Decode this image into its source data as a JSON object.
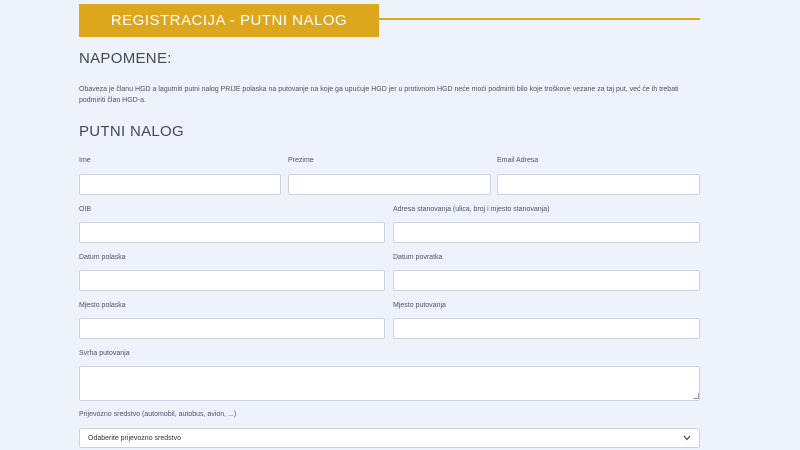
{
  "header": {
    "title": "REGISTRACIJA - PUTNI NALOG"
  },
  "notes": {
    "title": "NAPOMENE:",
    "text": "Obavеza je članu HGD a lagutniti putni nalog PRIJE polaska na putovanje na koje ga upućuje HGD jer u protivnom HGD neće moći podmiriti bilo koje troškove vezane za taj put, već će ih trebati podmiriti član HGD-a."
  },
  "form": {
    "title": "PUTNI NALOG",
    "ime_label": "Ime",
    "prezime_label": "Prezime",
    "email_label": "Email Adresa",
    "oib_label": "OIB",
    "adresa_label": "Adresa stanovanja (ulica, broj i mjesto stanovanja)",
    "datum_polaska_label": "Datum polaska",
    "datum_povratka_label": "Datum povratka",
    "mjesto_polaska_label": "Mjesto polaska",
    "mjesto_putovanja_label": "Mjesto putovanja",
    "svrha_label": "Svrha putovanja",
    "prijevozno_label": "Prijevozno sredstvo (automobil, autobus, avion, ...)",
    "prijevozno_selected": "Odaberite prijevozno sredstvo"
  },
  "icons": {
    "select_chevron": "chevron-down-icon"
  },
  "colors": {
    "accent": "#dca71c",
    "background": "#eef2fb"
  }
}
